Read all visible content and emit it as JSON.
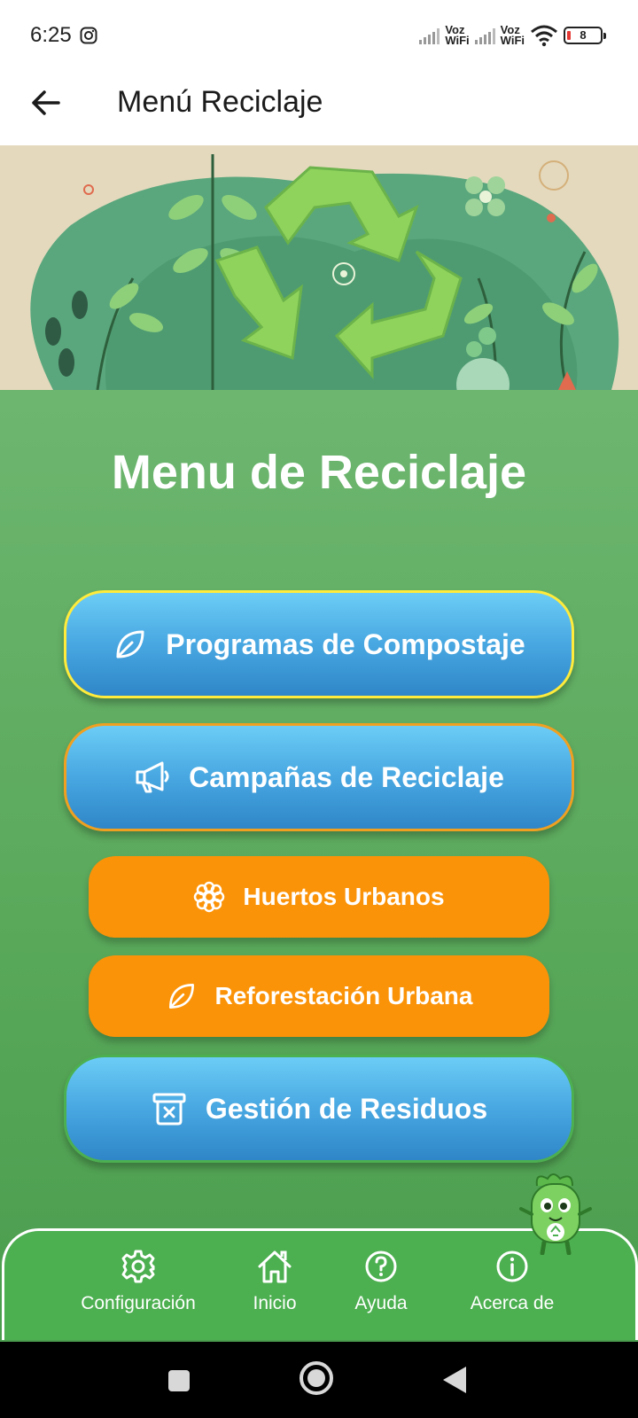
{
  "status_bar": {
    "time": "6:25",
    "sim1_label_top": "Voz",
    "sim1_label_bottom": "WiFi",
    "sim2_label_top": "Voz",
    "sim2_label_bottom": "WiFi",
    "battery": "8"
  },
  "app_bar": {
    "title": "Menú Reciclaje"
  },
  "main": {
    "title": "Menu de Reciclaje",
    "buttons": [
      {
        "label": "Programas de Compostaje",
        "icon": "leaf-icon",
        "style": "blue",
        "border": "#ffeb3b"
      },
      {
        "label": "Campañas de Reciclaje",
        "icon": "megaphone-icon",
        "style": "blue",
        "border": "#f0a020"
      },
      {
        "label": "Huertos Urbanos",
        "icon": "flower-icon",
        "style": "orange"
      },
      {
        "label": "Reforestación Urbana",
        "icon": "leaf-icon",
        "style": "orange"
      },
      {
        "label": "Gestión de Residuos",
        "icon": "trash-bin-icon",
        "style": "blue",
        "border": "#4caf50"
      }
    ]
  },
  "bottom_nav": {
    "items": [
      {
        "label": "Configuración",
        "icon": "gear-icon"
      },
      {
        "label": "Inicio",
        "icon": "home-icon"
      },
      {
        "label": "Ayuda",
        "icon": "help-icon"
      },
      {
        "label": "Acerca de",
        "icon": "info-icon"
      }
    ]
  },
  "colors": {
    "main_green": "#5aa95b",
    "nav_green": "#4caf50",
    "orange": "#fb9308",
    "blue_top": "#6bcdf6",
    "blue_bottom": "#2f86c8"
  }
}
